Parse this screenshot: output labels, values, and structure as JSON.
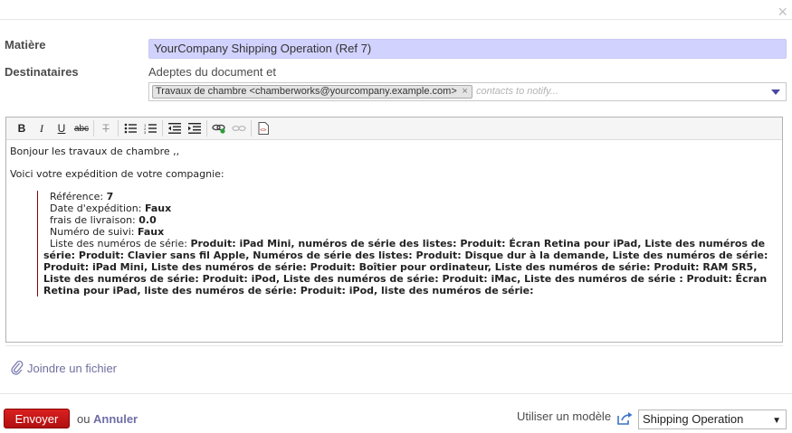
{
  "dialog": {
    "close_icon": "×"
  },
  "subject": {
    "label": "Matière",
    "value": "YourCompany Shipping Operation (Ref 7)"
  },
  "recipients": {
    "label": "Destinataires",
    "followers_text": "Adeptes du document et",
    "tag": "Travaux de chambre <chamberworks@yourcompany.example.com>",
    "tag_remove": "×",
    "placeholder": "contacts to notify..."
  },
  "toolbar": {
    "bold": "B",
    "italic": "I",
    "underline": "U",
    "strike": "abc",
    "clear_format": "T"
  },
  "body": {
    "greeting": "Bonjour les travaux de chambre ,,",
    "intro": "Voici votre expédition de votre compagnie:",
    "reference_label": "Référence: ",
    "reference_value": "7",
    "ship_date_label": "Date d'expédition: ",
    "ship_date_value": "Faux",
    "delivery_fee_label": "frais de livraison: ",
    "delivery_fee_value": "0.0",
    "tracking_label": "Numéro de suivi: ",
    "tracking_value": "Faux",
    "serials_label": "Liste des numéros de série: ",
    "serials_value": "Produit: iPad Mini, numéros de série des listes: Produit: Écran Retina pour iPad, Liste des numéros de série: Produit: Clavier sans fil Apple, Numéros de série des listes: Produit: Disque dur à la demande, Liste des numéros de série: Produit: iPad Mini, Liste des numéros de série: Produit: Boîtier pour ordinateur, Liste des numéros de série: Produit: RAM SR5, Liste des numéros de série: Produit: iPod, Liste des numéros de série: Produit: iMac, Liste des numéros de série : Produit: Écran Retina pour iPad, liste des numéros de série: Produit: iPod, liste des numéros de série:"
  },
  "attach": {
    "label": "Joindre un fichier"
  },
  "footer": {
    "send_label": "Envoyer",
    "or_text": "ou",
    "cancel_label": "Annuler",
    "template_label": "Utiliser un modèle",
    "template_value": "Shipping Operation"
  },
  "colors": {
    "send_button": "#c0161a",
    "subject_bg": "#d2d2ff",
    "link": "#6f6fa8"
  }
}
